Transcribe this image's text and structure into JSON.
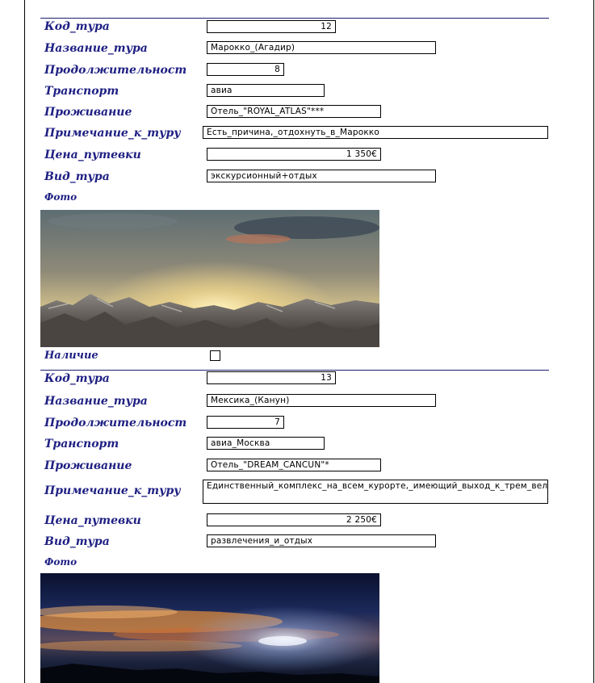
{
  "labels": {
    "kod": "Код_тура",
    "nazvanie": "Название_тура",
    "prodolzh": "Продолжительност",
    "transport": "Транспорт",
    "prozhivanie": "Проживание",
    "primechanie": "Примечание_к_туру",
    "cena": "Цена_путевки",
    "vid": "Вид_тура",
    "foto": "Фото",
    "nalichie": "Наличие"
  },
  "records": [
    {
      "kod": "12",
      "nazvanie": "Марокко_(Агадир)",
      "prodolzh": "8",
      "transport": "авиа",
      "prozhivanie": "Отель_\"ROYAL_ATLAS\"***",
      "primechanie": "Есть_причина,_отдохнуть_в_Марокко",
      "cena": "1 350€",
      "vid": "экскурсионный+отдых",
      "nalichie": false
    },
    {
      "kod": "13",
      "nazvanie": "Мексика_(Канун)",
      "prodolzh": "7",
      "transport": "авиа_Москва",
      "prozhivanie": "Отель_\"DREAM_CANCUN\"*",
      "primechanie": "Единственный_комплекс_на_всем_курорте,_имеющий_выход_к_трем_великолепным_пляжам",
      "cena": "2 250€",
      "vid": "развлечения_и_отдых"
    }
  ]
}
